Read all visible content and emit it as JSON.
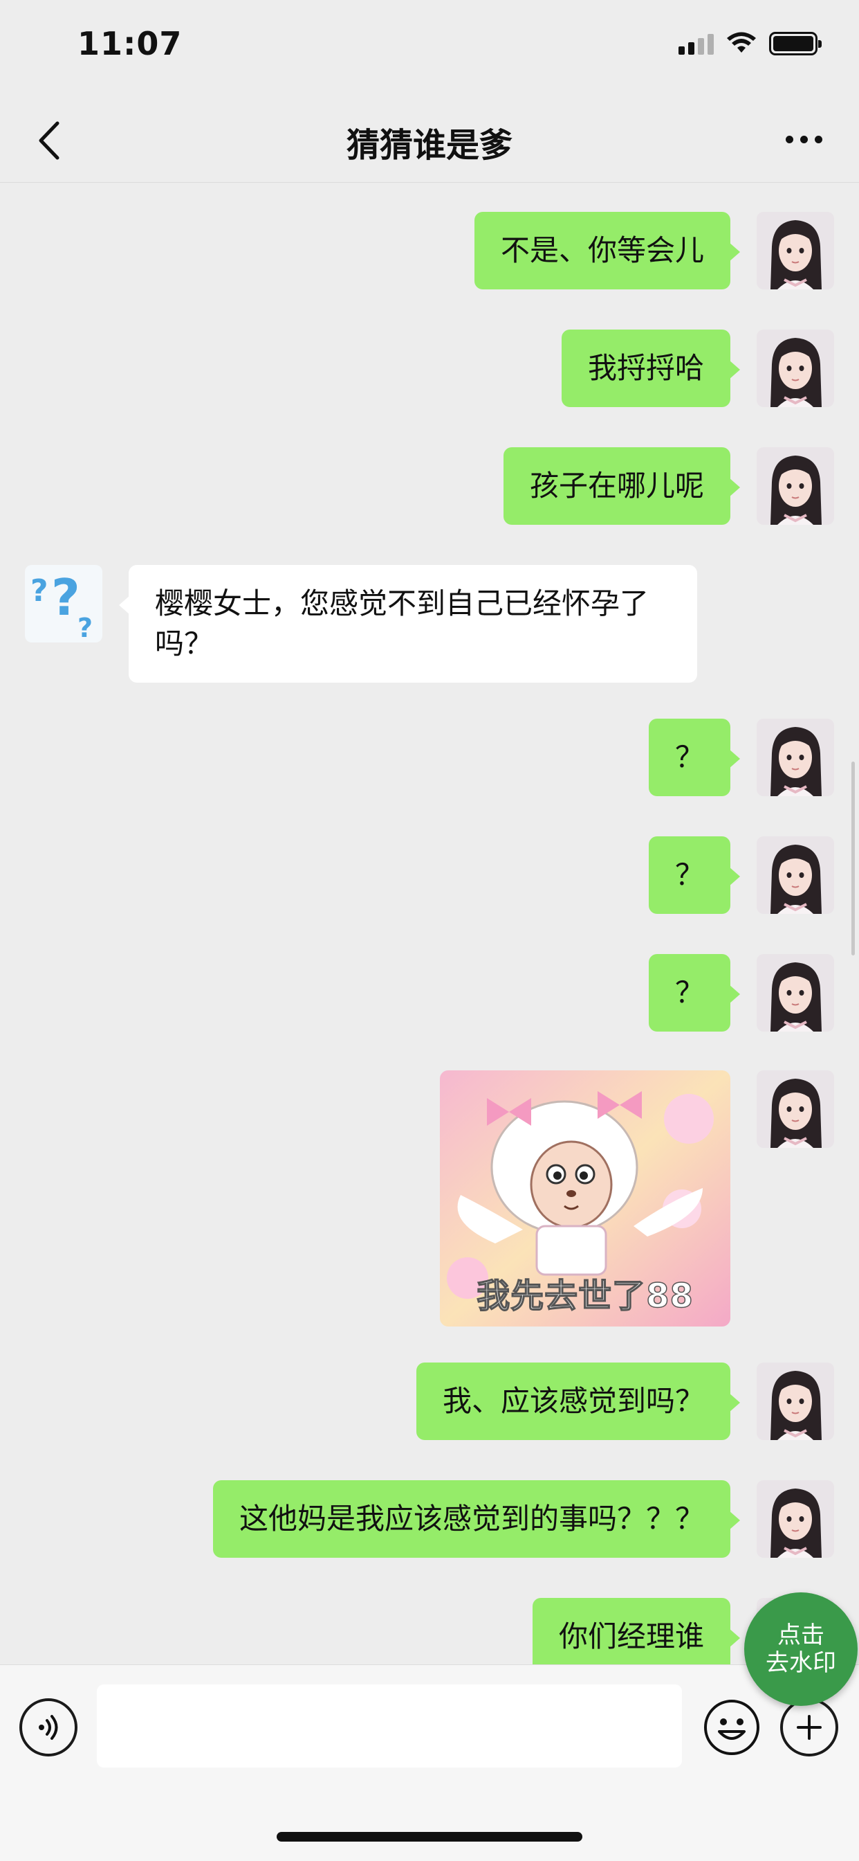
{
  "status_bar": {
    "time": "11:07"
  },
  "nav": {
    "title": "猜猜谁是爹"
  },
  "messages": [
    {
      "text": "不是、你等会儿"
    },
    {
      "text": "我捋捋哈"
    },
    {
      "text": "孩子在哪儿呢"
    },
    {
      "text": "樱樱女士，您感觉不到自己已经怀孕了吗？"
    },
    {
      "text": "？"
    },
    {
      "text": "？"
    },
    {
      "text": "？"
    },
    {
      "caption": "我先去世了88"
    },
    {
      "text": "我、应该感觉到吗？"
    },
    {
      "text": "这他妈是我应该感觉到的事吗？？？"
    },
    {
      "text": "你们经理谁"
    }
  ],
  "input": {
    "value": ""
  },
  "watermark_button": {
    "line1": "点击",
    "line2": "去水印"
  },
  "colors": {
    "my_bubble": "#95ec69",
    "other_bubble": "#ffffff",
    "background": "#ededed",
    "watermark_button": "#3a9a4a"
  }
}
